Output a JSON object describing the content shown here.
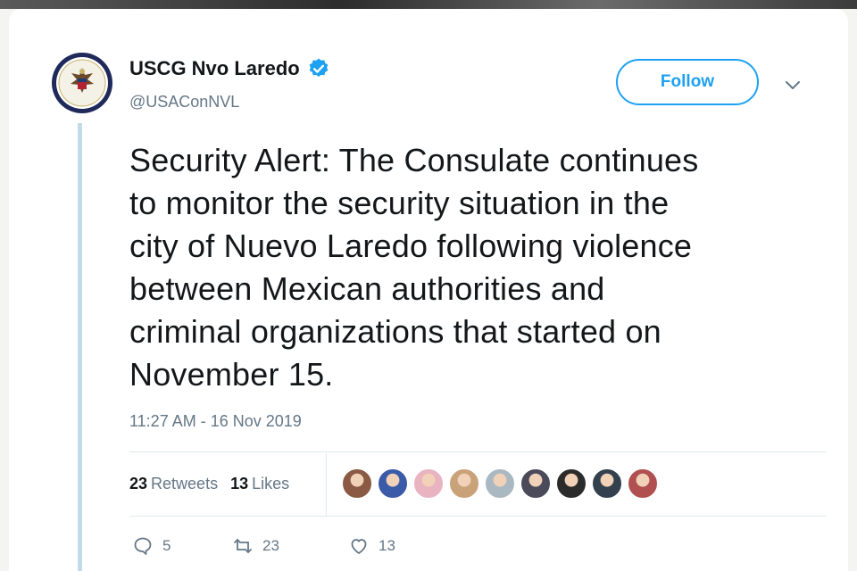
{
  "account": {
    "name": "USCG Nvo Laredo",
    "handle": "@USAConNVL",
    "verified": true
  },
  "follow_label": "Follow",
  "tweet": {
    "lines": [
      "Security Alert: The Consulate continues",
      "to monitor the security situation in the",
      "city of Nuevo Laredo following violence",
      "between Mexican authorities and",
      "criminal organizations that started on",
      "November 15."
    ],
    "timestamp": "11:27 AM - 16 Nov 2019"
  },
  "stats": {
    "retweets_count": "23",
    "retweets_label": "Retweets",
    "likes_count": "13",
    "likes_label": "Likes"
  },
  "liker_avatars": [
    {
      "color": "#8a5a44"
    },
    {
      "color": "#3b5aa8"
    },
    {
      "color": "#e9b3c0"
    },
    {
      "color": "#c9a27a"
    },
    {
      "color": "#aab8c2"
    },
    {
      "color": "#4a4a5a"
    },
    {
      "color": "#2b2b2b"
    },
    {
      "color": "#33404d"
    },
    {
      "color": "#b05050"
    }
  ],
  "actions": {
    "replies": "5",
    "retweets": "23",
    "likes": "13"
  },
  "colors": {
    "accent": "#1da1f2",
    "text": "#14171a",
    "secondary": "#657786",
    "thread": "#c3dbe6"
  },
  "icons": {
    "avatar": "us-state-department-seal",
    "verified": "verified-badge-icon",
    "chevron": "chevron-down-icon",
    "reply": "reply-icon",
    "retweet": "retweet-icon",
    "like": "heart-icon"
  }
}
